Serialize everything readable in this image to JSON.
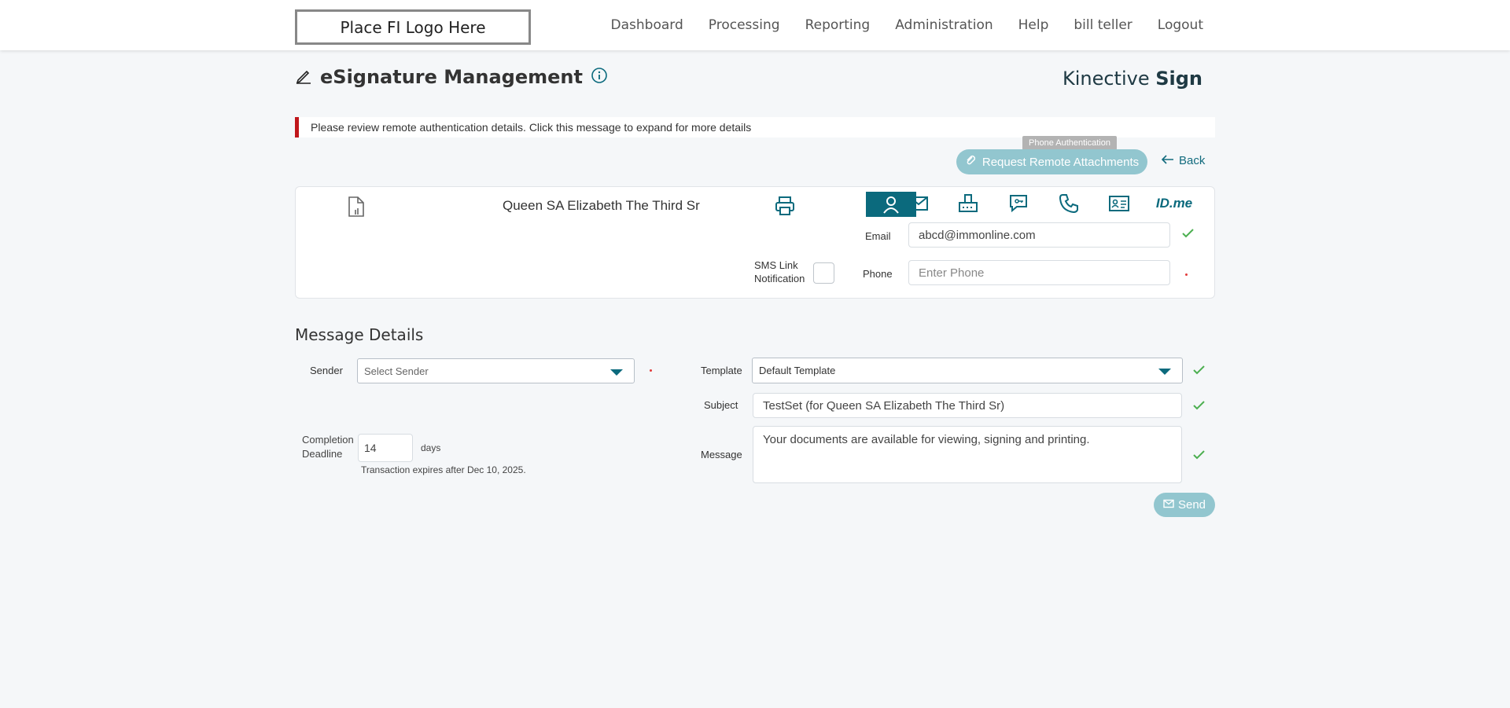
{
  "header": {
    "logo_text": "Place FI Logo Here",
    "nav": [
      "Dashboard",
      "Processing",
      "Reporting",
      "Administration",
      "Help",
      "bill teller",
      "Logout"
    ]
  },
  "page": {
    "title": "eSignature Management",
    "brand_light": "Kinective ",
    "brand_bold": "Sign"
  },
  "alert": {
    "text": "Please review remote authentication details. Click this message to expand for more details",
    "color": "#c0161b"
  },
  "actions": {
    "tooltip": "Phone Authentication",
    "attach_label": "Request Remote Attachments",
    "back_label": "Back"
  },
  "signer": {
    "name": "Queen SA Elizabeth The Third Sr",
    "email_label": "Email",
    "email_value": "abcd@immonline.com",
    "sms_label_1": "SMS Link",
    "sms_label_2": "Notification",
    "phone_label": "Phone",
    "phone_placeholder": "Enter Phone",
    "auth_icons": [
      "person-icon",
      "mail-icon",
      "fax-icon",
      "chat-icon",
      "phone-icon",
      "id-card-icon",
      "idme-icon"
    ],
    "idme_text": "ID.me"
  },
  "message": {
    "section_title": "Message Details",
    "sender_label": "Sender",
    "sender_placeholder": "Select Sender",
    "template_label": "Template",
    "template_value": "Default Template",
    "subject_label": "Subject",
    "subject_value": "TestSet (for Queen SA Elizabeth The Third Sr)",
    "message_label": "Message",
    "message_value": "Your documents are available for viewing, signing and printing.",
    "deadline_label_1": "Completion",
    "deadline_label_2": "Deadline",
    "deadline_value": "14",
    "days_label": "days",
    "expiry_text": "Transaction expires after Dec 10, 2025.",
    "send_label": "Send"
  },
  "colors": {
    "accent": "#0b6a7d",
    "button_disabled": "#92c6cf",
    "check": "#4caf50",
    "required": "#e23b3b"
  }
}
